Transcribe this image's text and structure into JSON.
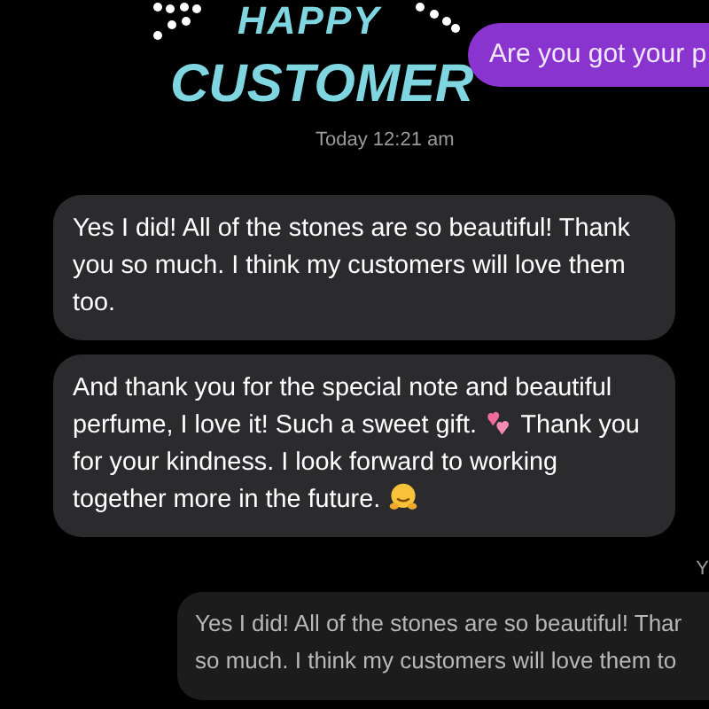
{
  "overlay": {
    "line_1": "HAPPY",
    "line_2": "CUSTOMER"
  },
  "sent_top": {
    "text": "Are you got your p"
  },
  "timestamp": "Today 12:21 am",
  "received": [
    {
      "segments": [
        {
          "kind": "text",
          "text": "Yes I did! All of the stones are so beautiful! Thank you so much. I think my customers will love them too."
        }
      ]
    },
    {
      "segments": [
        {
          "kind": "text",
          "text": "And thank you for the special note and beautiful perfume, I love it! Such a sweet gift. "
        },
        {
          "kind": "hearts"
        },
        {
          "kind": "text",
          "text": " Thank you for your kindness. I look forward to working together more in the future. "
        },
        {
          "kind": "hug"
        }
      ]
    }
  ],
  "timestamp_cut": "Y",
  "quoted": {
    "lines": [
      "Yes I did! All of the stones are so beautiful! Thar",
      "so much. I think my customers will love them to"
    ]
  }
}
